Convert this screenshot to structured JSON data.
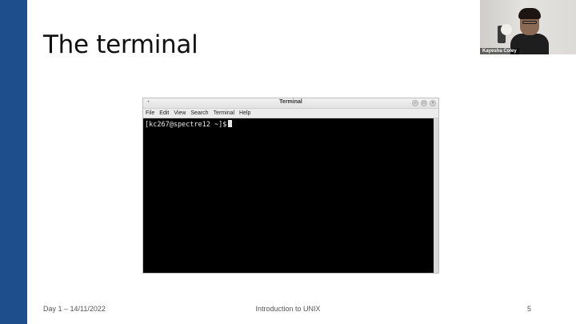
{
  "slide": {
    "title": "The terminal",
    "footer": {
      "left": "Day 1 – 14/11/2022",
      "center": "Introduction to UNIX",
      "page_number": "5"
    },
    "accent_color": "#1e4e8c"
  },
  "terminal": {
    "window_title": "Terminal",
    "menu": [
      "File",
      "Edit",
      "View",
      "Search",
      "Terminal",
      "Help"
    ],
    "prompt": "[kc267@spectre12 ~]$",
    "window_controls": [
      "minimize-icon",
      "maximize-icon",
      "close-icon"
    ]
  },
  "webcam": {
    "participant_name": "Kayesha Coley"
  }
}
